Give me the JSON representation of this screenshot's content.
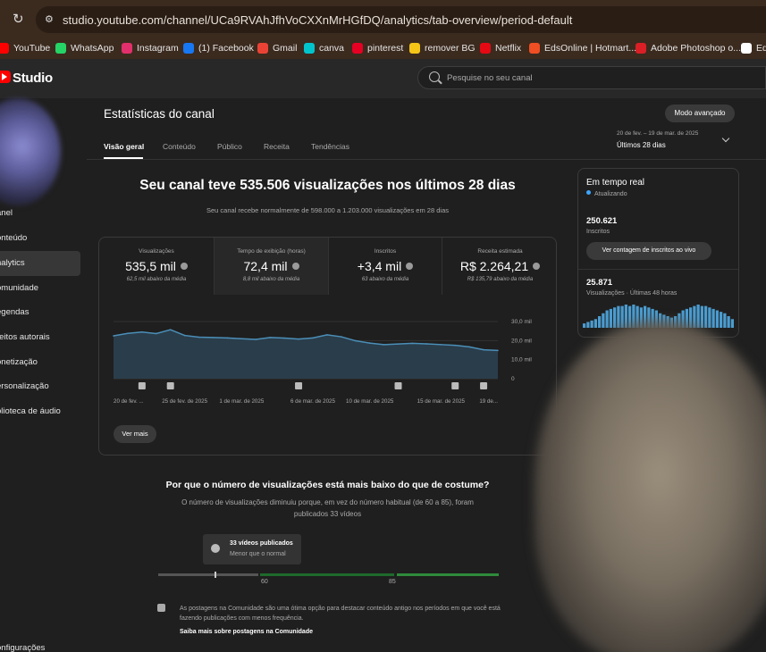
{
  "browser": {
    "url": "studio.youtube.com/channel/UCa9RVAhJfhVoCXXnMrHGfDQ/analytics/tab-overview/period-default",
    "bookmarks": [
      {
        "label": "YouTube",
        "icon": "youtube-icon",
        "color": "#ff0000"
      },
      {
        "label": "WhatsApp",
        "icon": "whatsapp-icon",
        "color": "#25d366"
      },
      {
        "label": "Instagram",
        "icon": "instagram-icon",
        "color": "#e1306c"
      },
      {
        "label": "(1) Facebook",
        "icon": "facebook-icon",
        "color": "#1877f2"
      },
      {
        "label": "Gmail",
        "icon": "gmail-icon",
        "color": "#ea4335"
      },
      {
        "label": "canva",
        "icon": "canva-icon",
        "color": "#00c4cc"
      },
      {
        "label": "pinterest",
        "icon": "pinterest-icon",
        "color": "#e60023"
      },
      {
        "label": "remover BG",
        "icon": "remover-bg-icon",
        "color": "#f5c518"
      },
      {
        "label": "Netflix",
        "icon": "netflix-icon",
        "color": "#e50914"
      },
      {
        "label": "EdsOnline | Hotmart...",
        "icon": "hotmart-icon",
        "color": "#f04e23"
      },
      {
        "label": "Adobe Photoshop o...",
        "icon": "adobe-icon",
        "color": "#da1f26"
      },
      {
        "label": "Ed",
        "icon": "p-icon",
        "color": "#ffffff"
      }
    ]
  },
  "studio": {
    "logo_text": "Studio",
    "search_placeholder": "Pesquise no seu canal"
  },
  "sidebar": {
    "items": [
      {
        "label": "anel",
        "active": false
      },
      {
        "label": "onteúdo",
        "active": false
      },
      {
        "label": "nalytics",
        "active": true
      },
      {
        "label": "omunidade",
        "active": false
      },
      {
        "label": "egendas",
        "active": false
      },
      {
        "label": "reitos autorais",
        "active": false
      },
      {
        "label": "onetização",
        "active": false
      },
      {
        "label": "ersonalização",
        "active": false
      },
      {
        "label": "blioteca de áudio",
        "active": false
      }
    ],
    "settings_label": "onfigurações"
  },
  "page": {
    "title": "Estatísticas do canal",
    "advanced_button": "Modo avançado",
    "tabs": [
      {
        "label": "Visão geral",
        "active": true
      },
      {
        "label": "Conteúdo",
        "active": false
      },
      {
        "label": "Público",
        "active": false
      },
      {
        "label": "Receita",
        "active": false
      },
      {
        "label": "Tendências",
        "active": false
      }
    ],
    "period_range": "20 de fev. – 19 de mar. de 2025",
    "period_label": "Últimos 28 dias"
  },
  "overview": {
    "headline": "Seu canal teve 535.506 visualizações nos últimos 28 dias",
    "subheadline": "Seu canal recebe normalmente de 598.000 a 1.203.000 visualizações em 28 dias",
    "metrics": [
      {
        "label": "Visualizações",
        "value": "535,5 mil",
        "note": "62,5 mil abaixo da média",
        "selected": false
      },
      {
        "label": "Tempo de exibição (horas)",
        "value": "72,4 mil",
        "note": "8,8 mil abaixo da média",
        "selected": true
      },
      {
        "label": "Inscritos",
        "value": "+3,4 mil",
        "note": "63 abaixo da média",
        "selected": false
      },
      {
        "label": "Receita estimada",
        "value": "R$ 2.264,21",
        "note": "R$ 135,79 abaixo da média",
        "selected": false
      }
    ],
    "see_more": "Ver mais"
  },
  "chart_data": {
    "type": "area",
    "x": [
      "20 de fev.",
      "21",
      "22",
      "23",
      "24",
      "25 de fev. de 2025",
      "26",
      "27",
      "28",
      "1 de mar. de 2025",
      "2",
      "3",
      "4",
      "5",
      "6 de mar. de 2025",
      "7",
      "8",
      "9",
      "10 de mar. de 2025",
      "11",
      "12",
      "13",
      "14",
      "15 de mar. de 2025",
      "16",
      "17",
      "18",
      "19 de..."
    ],
    "x_tick_labels": [
      "20 de fev. ...",
      "25 de fev. de 2025",
      "1 de mar. de 2025",
      "6 de mar. de 2025",
      "10 de mar. de 2025",
      "15 de mar. de 2025",
      "19 de..."
    ],
    "series": [
      {
        "values": [
          22500,
          23800,
          24500,
          23700,
          25700,
          22700,
          21800,
          21600,
          21400,
          21000,
          20600,
          21600,
          21300,
          20800,
          21400,
          23000,
          22000,
          19900,
          18700,
          17900,
          18200,
          18600,
          18300,
          17900,
          17500,
          16700,
          15200,
          14800
        ]
      }
    ],
    "y_ticks": [
      "30,0 mil",
      "20,0 mil",
      "10,0 mil",
      "0"
    ],
    "ylim": [
      0,
      30000
    ],
    "upload_markers_at": [
      "5",
      "12",
      "15",
      "16",
      "18",
      "19",
      "22",
      "24"
    ],
    "color": "#4b8fb8",
    "fill": "#2a3d4b"
  },
  "why": {
    "title": "Por que o número de visualizações está mais baixo do que de costume?",
    "body": "O número de visualizações diminuiu porque, em vez do número habitual (de 60 a 85), foram publicados 33 vídeos",
    "tooltip_title": "33 vídeos publicados",
    "tooltip_sub": "Menor que o normal",
    "range_low": "60",
    "range_high": "85",
    "range_marker_value": 33,
    "community_text": "As postagens na Comunidade são uma ótima opção para destacar conteúdo antigo nos períodos em que você está fazendo publicações com menos frequência.",
    "community_link": "Saiba mais sobre postagens na Comunidade"
  },
  "realtime": {
    "title": "Em tempo real",
    "live": "Atualizando",
    "subscribers": "250.621",
    "subscribers_label": "Inscritos",
    "subscribers_button": "Ver contagem de inscritos ao vivo",
    "views": "25.871",
    "views_label": "Visualizações · Últimas 48 horas",
    "bar_values": [
      3,
      4,
      5,
      6,
      8,
      10,
      12,
      13,
      14,
      15,
      15,
      16,
      15,
      16,
      15,
      14,
      15,
      14,
      13,
      12,
      10,
      9,
      8,
      7,
      8,
      10,
      12,
      13,
      14,
      15,
      16,
      15,
      15,
      14,
      13,
      12,
      11,
      10,
      8,
      6
    ]
  }
}
